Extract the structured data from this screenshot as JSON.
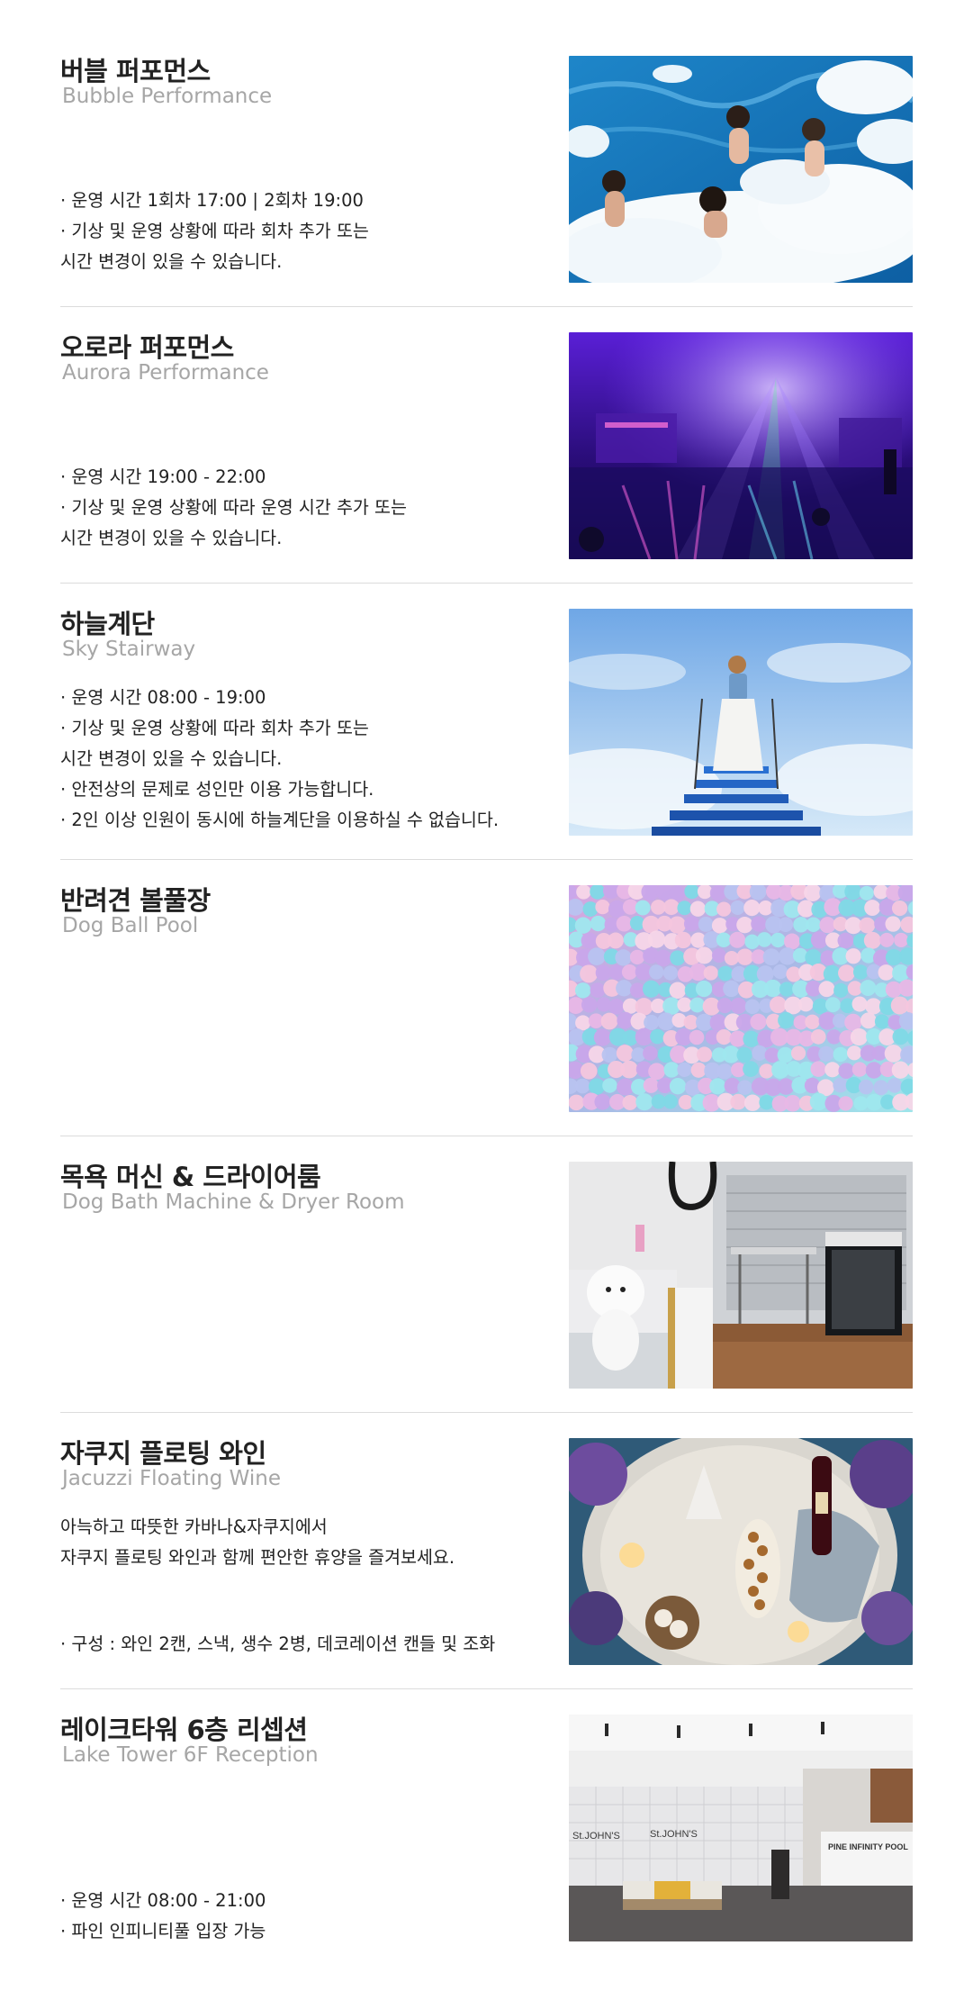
{
  "sections": [
    {
      "title": "버블 퍼포먼스",
      "subtitle": "Bubble Performance",
      "bullets": [
        "· 운영 시간   1회차 17:00  |  2회차 19:00",
        "· 기상 및 운영 상황에 따라 회차 추가 또는",
        "   시간 변경이 있을 수 있습니다."
      ]
    },
    {
      "title": "오로라 퍼포먼스",
      "subtitle": "Aurora Performance",
      "bullets": [
        "· 운영 시간   19:00 - 22:00",
        "· 기상 및 운영 상황에 따라 운영 시간 추가 또는",
        "   시간 변경이 있을 수 있습니다."
      ]
    },
    {
      "title": "하늘계단",
      "subtitle": "Sky Stairway",
      "bullets": [
        "· 운영 시간   08:00 - 19:00",
        "· 기상 및 운영 상황에 따라 회차 추가 또는",
        "   시간 변경이 있을 수 있습니다.",
        "· 안전상의 문제로 성인만 이용 가능합니다.",
        "· 2인 이상 인원이 동시에 하늘계단을 이용하실 수 없습니다."
      ]
    },
    {
      "title": "반려견 볼풀장",
      "subtitle": "Dog Ball Pool",
      "bullets": []
    },
    {
      "title": "목욕 머신 & 드라이어룸",
      "subtitle": "Dog Bath Machine & Dryer Room",
      "bullets": []
    },
    {
      "title": "자쿠지 플로팅 와인",
      "subtitle": "Jacuzzi Floating Wine",
      "desc": [
        "아늑하고 따뜻한 카바나&자쿠지에서",
        "자쿠지 플로팅 와인과 함께 편안한 휴양을 즐겨보세요."
      ],
      "bullets": [
        "· 구성 : 와인 2캔, 스낵, 생수 2병, 데코레이션 캔들 및 조화"
      ]
    },
    {
      "title": "레이크타워 6층 리셉션",
      "subtitle": "Lake Tower 6F Reception",
      "bullets": [
        "· 운영 시간   08:00 - 21:00",
        "· 파인 인피니티풀 입장 가능"
      ],
      "photo_signs": [
        "St.JOHN'S",
        "St.JOHN'S",
        "PINE INFINITY POOL"
      ]
    }
  ],
  "colors": {
    "title": "#222222",
    "subtitle": "#a6a6a6",
    "divider": "#dcdcdc"
  }
}
